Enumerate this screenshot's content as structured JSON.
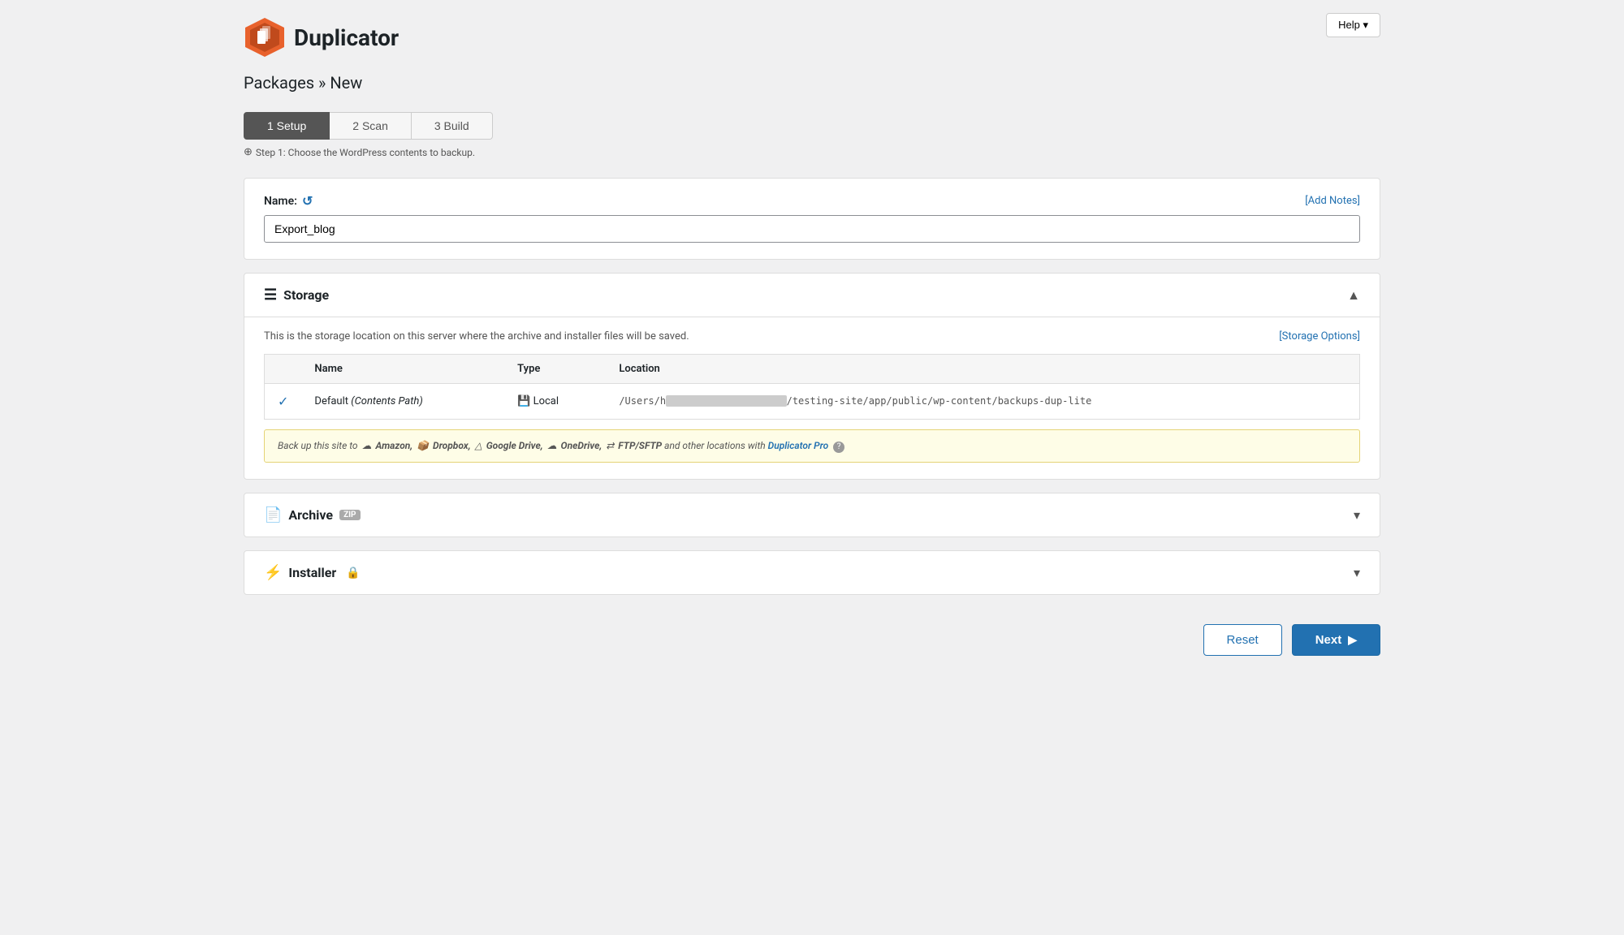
{
  "app": {
    "logo_text": "Duplicator",
    "help_label": "Help ▾"
  },
  "breadcrumb": {
    "text": "Packages » New"
  },
  "steps": {
    "items": [
      {
        "label": "1 Setup",
        "active": true
      },
      {
        "label": "2 Scan",
        "active": false
      },
      {
        "label": "3 Build",
        "active": false
      }
    ],
    "hint": "Step 1: Choose the WordPress contents to backup."
  },
  "name_section": {
    "label": "Name:",
    "value": "Export_blog",
    "add_notes_label": "[Add Notes]",
    "placeholder": ""
  },
  "storage_section": {
    "title": "Storage",
    "collapse_icon": "▲",
    "description": "This is the storage location on this server where the archive and installer files will be saved.",
    "options_link": "[Storage Options]",
    "table": {
      "headers": [
        "Name",
        "Type",
        "Location"
      ],
      "rows": [
        {
          "checked": true,
          "name": "Default",
          "name_italic": "(Contents Path)",
          "type_icon": "💾",
          "type_label": "Local",
          "location_prefix": "/Users/h",
          "location_blurred": "████████████████████",
          "location_suffix": "/testing-site/app/public/wp-content/backups-dup-lite"
        }
      ]
    },
    "upgrade_notice": {
      "prefix": "Back up this site to",
      "services": [
        "Amazon",
        "Dropbox",
        "Google Drive",
        "OneDrive",
        "FTP/SFTP"
      ],
      "suffix": "and other locations with",
      "pro_link": "Duplicator Pro",
      "help_icon": "?"
    }
  },
  "archive_section": {
    "title": "Archive",
    "badge": "zip",
    "collapse_icon": "▾"
  },
  "installer_section": {
    "title": "Installer",
    "lock_icon": "🔒",
    "collapse_icon": "▾"
  },
  "bottom_bar": {
    "reset_label": "Reset",
    "next_label": "Next",
    "next_arrow": "▶"
  }
}
